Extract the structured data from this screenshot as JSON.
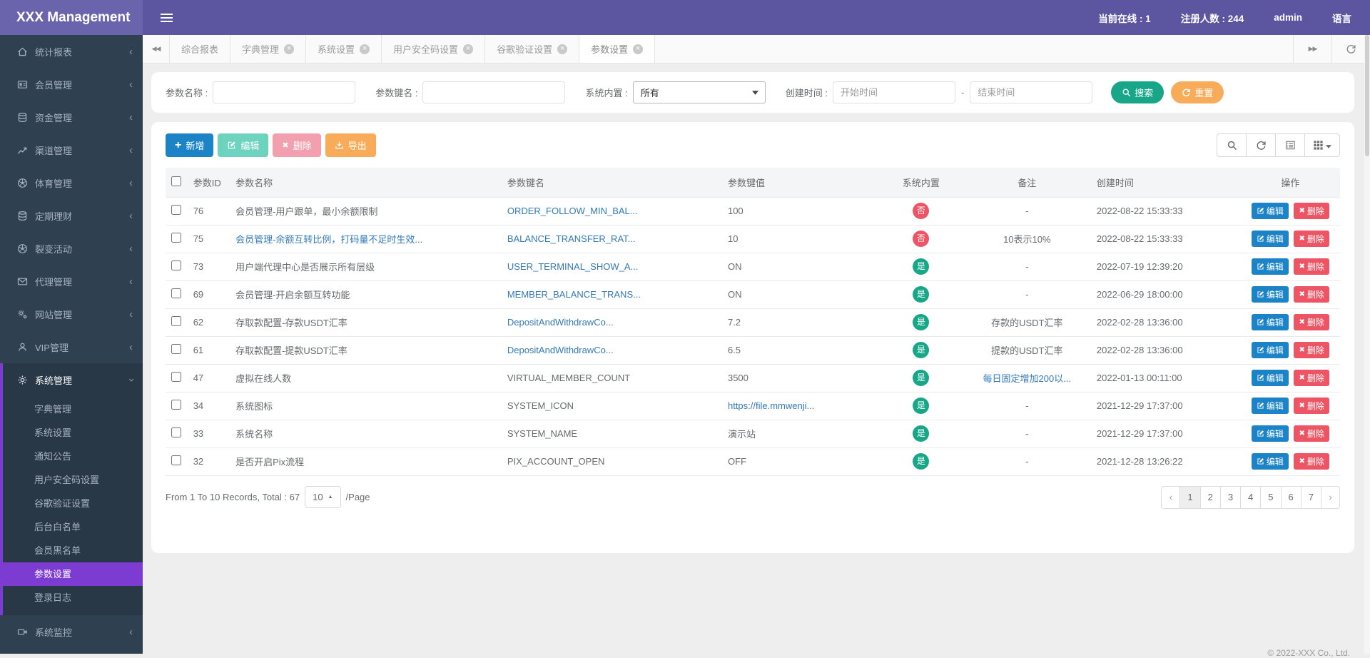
{
  "colors": {
    "navbar_bg": "#5c56a0",
    "brand_bg": "#6a64ac",
    "sidebar_bg": "#2f4050",
    "sidebar_group_bg": "#293846",
    "accent_purple": "#7c3bd1",
    "primary_blue": "#1c84c6",
    "success_green": "#18a689",
    "warning_orange": "#f8ac59",
    "danger_red": "#ed5565",
    "link_blue": "#337ab7"
  },
  "navbar": {
    "brand": "XXX Management",
    "online": "当前在线 : 1",
    "registered": "注册人数 : 244",
    "user": "admin",
    "language": "语言"
  },
  "sidebar": {
    "items": [
      {
        "label": "统计报表",
        "icon": "home-icon"
      },
      {
        "label": "会员管理",
        "icon": "id-card-icon"
      },
      {
        "label": "资金管理",
        "icon": "database-icon"
      },
      {
        "label": "渠道管理",
        "icon": "line-chart-icon"
      },
      {
        "label": "体育管理",
        "icon": "soccer-icon"
      },
      {
        "label": "定期理财",
        "icon": "database-icon"
      },
      {
        "label": "裂变活动",
        "icon": "soccer-icon"
      },
      {
        "label": "代理管理",
        "icon": "envelope-icon"
      },
      {
        "label": "网站管理",
        "icon": "cogs-icon"
      },
      {
        "label": "VIP管理",
        "icon": "user-icon"
      },
      {
        "label": "系统管理",
        "icon": "gear-icon",
        "expanded": true,
        "children": [
          {
            "label": "字典管理"
          },
          {
            "label": "系统设置"
          },
          {
            "label": "通知公告"
          },
          {
            "label": "用户安全码设置"
          },
          {
            "label": "谷歌验证设置"
          },
          {
            "label": "后台白名单"
          },
          {
            "label": "会员黑名单"
          },
          {
            "label": "参数设置",
            "active": true
          },
          {
            "label": "登录日志"
          }
        ]
      },
      {
        "label": "系统监控",
        "icon": "camera-icon"
      }
    ]
  },
  "tabbar": {
    "tabs": [
      {
        "label": "综合报表",
        "closable": false
      },
      {
        "label": "字典管理",
        "closable": true
      },
      {
        "label": "系统设置",
        "closable": true
      },
      {
        "label": "用户安全码设置",
        "closable": true
      },
      {
        "label": "谷歌验证设置",
        "closable": true
      },
      {
        "label": "参数设置",
        "closable": true,
        "active": true
      }
    ]
  },
  "filters": {
    "name_label": "参数名称 :",
    "key_label": "参数键名 :",
    "builtin_label": "系统内置 :",
    "builtin_value": "所有",
    "created_label": "创建时间 :",
    "start_placeholder": "开始时间",
    "end_placeholder": "结束时间",
    "search_label": "搜索",
    "reset_label": "重置"
  },
  "toolbar": {
    "add": "新增",
    "edit": "编辑",
    "delete": "删除",
    "export": "导出"
  },
  "table": {
    "columns": [
      "参数ID",
      "参数名称",
      "参数键名",
      "参数键值",
      "系统内置",
      "备注",
      "创建时间",
      "操作"
    ],
    "row_actions": {
      "edit": "编辑",
      "delete": "删除"
    },
    "rows": [
      {
        "id": "76",
        "name": "会员管理-用户跟单，最小余额限制",
        "name_link": false,
        "key": "ORDER_FOLLOW_MIN_BAL...",
        "key_link": true,
        "value": "100",
        "value_link": false,
        "builtin": "否",
        "remark": "-",
        "remark_link": false,
        "created": "2022-08-22 15:33:33"
      },
      {
        "id": "75",
        "name": "会员管理-余额互转比例，打码量不足时生效...",
        "name_link": true,
        "key": "BALANCE_TRANSFER_RAT...",
        "key_link": true,
        "value": "10",
        "value_link": false,
        "builtin": "否",
        "remark": "10表示10%",
        "remark_link": false,
        "created": "2022-08-22 15:33:33"
      },
      {
        "id": "73",
        "name": "用户端代理中心是否展示所有层级",
        "name_link": false,
        "key": "USER_TERMINAL_SHOW_A...",
        "key_link": true,
        "value": "ON",
        "value_link": false,
        "builtin": "是",
        "remark": "-",
        "remark_link": false,
        "created": "2022-07-19 12:39:20"
      },
      {
        "id": "69",
        "name": "会员管理-开启余额互转功能",
        "name_link": false,
        "key": "MEMBER_BALANCE_TRANS...",
        "key_link": true,
        "value": "ON",
        "value_link": false,
        "builtin": "是",
        "remark": "-",
        "remark_link": false,
        "created": "2022-06-29 18:00:00"
      },
      {
        "id": "62",
        "name": "存取款配置-存款USDT汇率",
        "name_link": false,
        "key": "DepositAndWithdrawCo...",
        "key_link": true,
        "value": "7.2",
        "value_link": false,
        "builtin": "是",
        "remark": "存款的USDT汇率",
        "remark_link": false,
        "created": "2022-02-28 13:36:00"
      },
      {
        "id": "61",
        "name": "存取款配置-提款USDT汇率",
        "name_link": false,
        "key": "DepositAndWithdrawCo...",
        "key_link": true,
        "value": "6.5",
        "value_link": false,
        "builtin": "是",
        "remark": "提款的USDT汇率",
        "remark_link": false,
        "created": "2022-02-28 13:36:00"
      },
      {
        "id": "47",
        "name": "虚拟在线人数",
        "name_link": false,
        "key": "VIRTUAL_MEMBER_COUNT",
        "key_link": false,
        "value": "3500",
        "value_link": false,
        "builtin": "是",
        "remark": "每日固定增加200以...",
        "remark_link": true,
        "created": "2022-01-13 00:11:00"
      },
      {
        "id": "34",
        "name": "系统图标",
        "name_link": false,
        "key": "SYSTEM_ICON",
        "key_link": false,
        "value": "https://file.mmwenji...",
        "value_link": true,
        "builtin": "是",
        "remark": "-",
        "remark_link": false,
        "created": "2021-12-29 17:37:00"
      },
      {
        "id": "33",
        "name": "系统名称",
        "name_link": false,
        "key": "SYSTEM_NAME",
        "key_link": false,
        "value": "演示站",
        "value_link": false,
        "builtin": "是",
        "remark": "-",
        "remark_link": false,
        "created": "2021-12-29 17:37:00"
      },
      {
        "id": "32",
        "name": "是否开启Pix流程",
        "name_link": false,
        "key": "PIX_ACCOUNT_OPEN",
        "key_link": false,
        "value": "OFF",
        "value_link": false,
        "builtin": "是",
        "remark": "-",
        "remark_link": false,
        "created": "2021-12-28 13:26:22"
      }
    ]
  },
  "pagination": {
    "summary": "From 1 To 10 Records, Total : 67",
    "page_size": "10",
    "per_page_suffix": "/Page",
    "pages": [
      "1",
      "2",
      "3",
      "4",
      "5",
      "6",
      "7"
    ],
    "active_page": "1",
    "prev": "‹",
    "next": "›"
  },
  "footer": {
    "copyright": "© 2022-XXX Co., Ltd."
  }
}
